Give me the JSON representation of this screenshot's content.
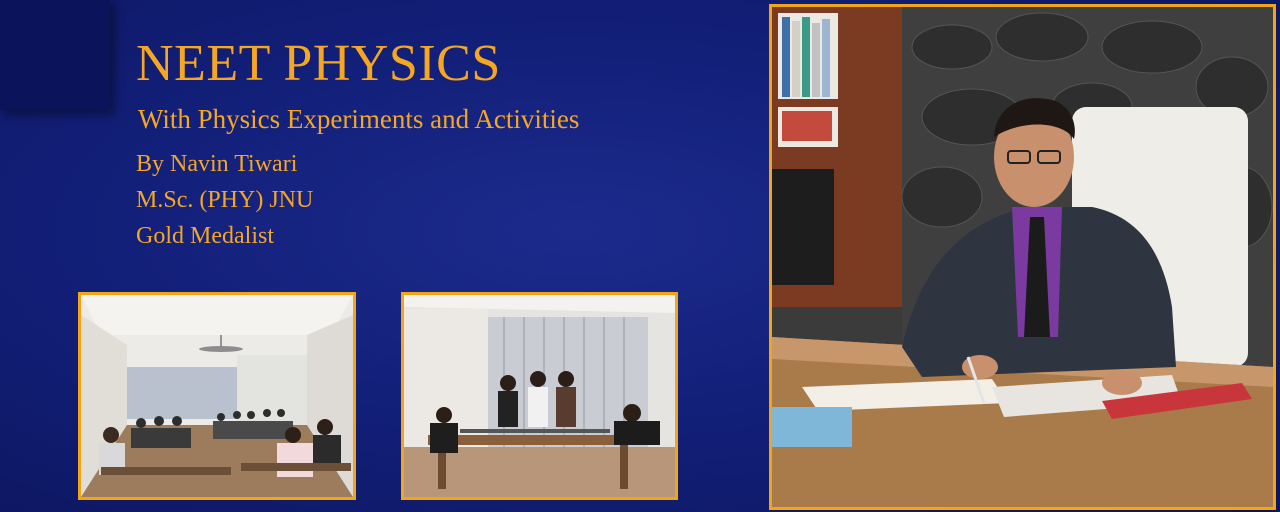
{
  "banner": {
    "title": "NEET PHYSICS",
    "subtitle": "With Physics Experiments and Activities",
    "author": "By Navin Tiwari",
    "degree": "M.Sc. (PHY) JNU",
    "award": "Gold Medalist"
  },
  "colors": {
    "background": "#13207a",
    "accent": "#f5a623"
  },
  "photos": [
    "classroom-photo",
    "lab-experiment-photo",
    "teacher-portrait-photo"
  ]
}
